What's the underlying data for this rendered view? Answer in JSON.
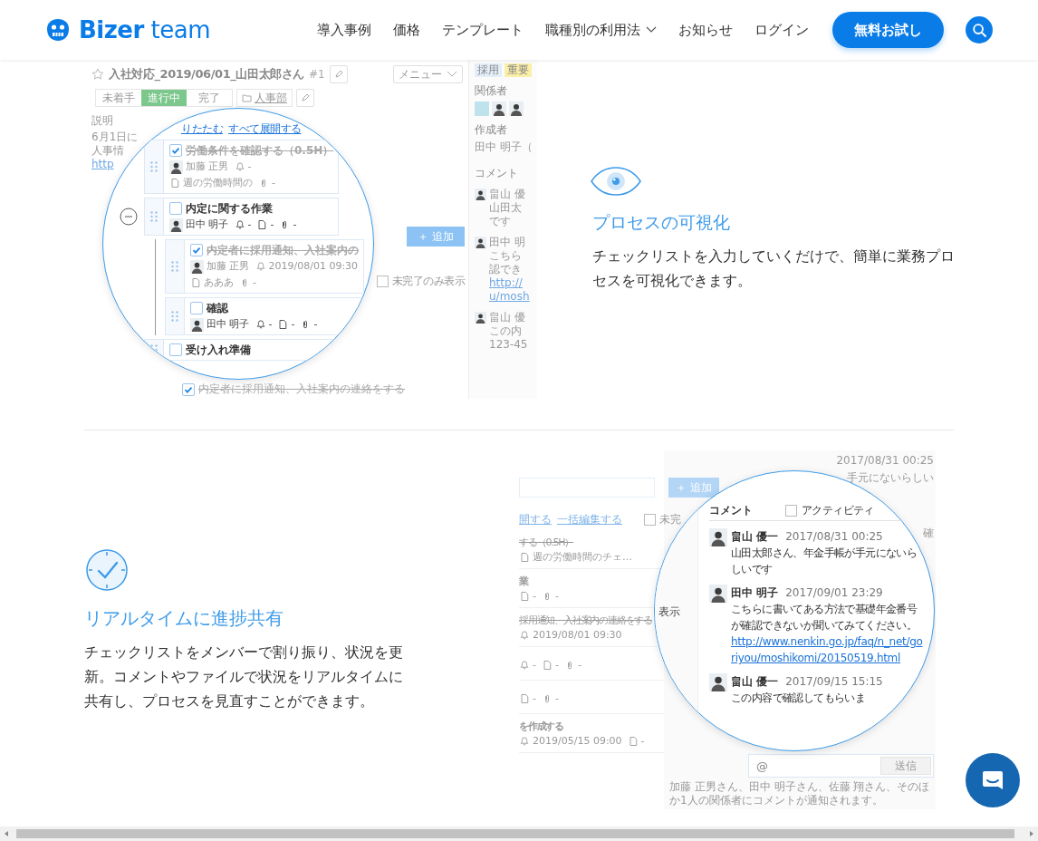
{
  "header": {
    "logo": "**Bizer** team",
    "nav": [
      {
        "label": "導入事例",
        "dropdown": false
      },
      {
        "label": "価格",
        "dropdown": false
      },
      {
        "label": "テンプレート",
        "dropdown": false
      },
      {
        "label": "職種別の利用法",
        "dropdown": true
      },
      {
        "label": "お知らせ",
        "dropdown": false
      },
      {
        "label": "ログイン",
        "dropdown": false
      }
    ],
    "cta": "無料お試し"
  },
  "process_feature": {
    "screenshot": {
      "title": "入社対応_2019/06/01_山田太郎さん",
      "number": "#1",
      "menu": "メニュー",
      "statuses": [
        {
          "label": "未着手",
          "selected": false
        },
        {
          "label": "進行中",
          "selected": true
        },
        {
          "label": "完了",
          "selected": false
        }
      ],
      "folder": "人事部",
      "description": {
        "label": "説明",
        "lines": [
          "6月1日に",
          "人事情"
        ],
        "link": "http"
      },
      "sidebar": {
        "tags": [
          {
            "label": "採用",
            "color": "#e3eef9"
          },
          {
            "label": "重要",
            "color": "#fbf0a8"
          }
        ],
        "members_label": "関係者",
        "author_label": "作成者",
        "author": "田中 明子（",
        "comments_label": "コメント",
        "comments": [
          {
            "name": "畠山 優",
            "text": [
              "山田太",
              "です"
            ]
          },
          {
            "name": "田中 明",
            "text": [
              "こちら",
              "認でき"
            ],
            "link": [
              "http://",
              "u/mosh"
            ]
          },
          {
            "name": "畠山 優",
            "text": [
              "この内",
              "123-45"
            ]
          }
        ]
      },
      "add_button": "＋ 追加",
      "filter": {
        "label": "未完了のみ表示",
        "checked": false
      },
      "background_task": {
        "title": "内定者に採用通知、入社案内の連絡をする",
        "checked": true
      },
      "lens": {
        "links": [
          "りたたむ",
          "すべて展開する"
        ],
        "tasks": [
          {
            "title": "労働条件を確認する（0.5H）",
            "checked": true,
            "meta": [
              {
                "kind": "person",
                "text": "加藤 正男"
              },
              {
                "kind": "reminder",
                "text": "-"
              },
              {
                "kind": "file",
                "text": "週の労働時間の"
              },
              {
                "kind": "clip",
                "text": "-"
              }
            ]
          },
          {
            "title": "内定に関する作業",
            "checked": false,
            "expanded": true,
            "meta": [
              {
                "kind": "person",
                "text": "田中 明子"
              },
              {
                "kind": "reminder",
                "text": "-"
              },
              {
                "kind": "file",
                "text": "-"
              },
              {
                "kind": "clip",
                "text": "-"
              }
            ],
            "children": [
              {
                "title": "内定者に採用通知、入社案内の",
                "checked": true,
                "meta": [
                  {
                    "kind": "person",
                    "text": "加藤 正男"
                  },
                  {
                    "kind": "reminder",
                    "text": "2019/08/01 09:30"
                  },
                  {
                    "kind": "file",
                    "text": "あああ"
                  },
                  {
                    "kind": "clip",
                    "text": "-"
                  }
                ]
              },
              {
                "title": "確認",
                "checked": false,
                "meta": [
                  {
                    "kind": "person",
                    "text": "田中 明子"
                  },
                  {
                    "kind": "reminder",
                    "text": "-"
                  },
                  {
                    "kind": "file",
                    "text": "-"
                  },
                  {
                    "kind": "clip",
                    "text": "-"
                  }
                ]
              }
            ]
          },
          {
            "title": "受け入れ準備",
            "checked": false
          }
        ]
      }
    },
    "title": "プロセスの可視化",
    "body": "チェックリストを入力していくだけで、簡単に業務プロセスを可視化できます。"
  },
  "realtime_feature": {
    "title": "リアルタイムに進捗共有",
    "body": "チェックリストをメンバーで割り振り、状況を更新。コメントやファイルで状況をリアルタイムに共有し、プロセスを見直すことができます。",
    "screenshot": {
      "add_button": "＋ 追加",
      "links": [
        "開する",
        "一括編集する"
      ],
      "filter": {
        "label": "未完",
        "checked": false
      },
      "tasks": [
        {
          "title": "する（0.5H）",
          "checked": true,
          "meta": [
            {
              "kind": "file",
              "text": "週の労働時間のチェ…"
            }
          ]
        },
        {
          "title": "業",
          "checked": false,
          "meta": [
            {
              "kind": "file",
              "text": "-"
            },
            {
              "kind": "clip",
              "text": "-"
            }
          ]
        },
        {
          "title": "採用通知、入社案内の連絡をする",
          "checked": true,
          "meta": [
            {
              "kind": "reminder",
              "text": "2019/08/01 09:30"
            }
          ]
        },
        {
          "meta": [
            {
              "kind": "reminder",
              "text": "-"
            },
            {
              "kind": "file",
              "text": "-"
            },
            {
              "kind": "clip",
              "text": "-"
            }
          ]
        },
        {
          "meta": [
            {
              "kind": "file",
              "text": "-"
            },
            {
              "kind": "clip",
              "text": "-"
            }
          ]
        },
        {
          "title": "を作成する",
          "checked": false,
          "meta": [
            {
              "kind": "reminder",
              "text": "2019/05/15 09:00"
            },
            {
              "kind": "file",
              "text": "-"
            }
          ]
        }
      ],
      "top_date": "2017/08/31 00:25",
      "top_text": "手元にないらしい",
      "edge_text": "確",
      "composer": {
        "placeholder": "@",
        "send": "送信",
        "note": "加藤 正男さん、田中 明子さん、佐藤 翔さん、そのほか1人の関係者にコメントが通知されます。"
      },
      "lens": {
        "side_text": "表示",
        "comments_label": "コメント",
        "activity": {
          "label": "アクティビティ",
          "checked": false
        },
        "comments": [
          {
            "name": "畠山 優一",
            "date": "2017/08/31 00:25",
            "text": "山田太郎さん、年金手帳が手元にないらしいです"
          },
          {
            "name": "田中 明子",
            "date": "2017/09/01 23:29",
            "text": "こちらに書いてある方法で基礎年金番号が確認できないか聞いてみてください。",
            "link": "http://www.nenkin.go.jp/faq/n_net/goriyou/moshikomi/20150519.html"
          },
          {
            "name": "畠山 優一",
            "date": "2017/09/15 15:15",
            "text": "この内容で確認してもらいま"
          }
        ]
      }
    }
  }
}
